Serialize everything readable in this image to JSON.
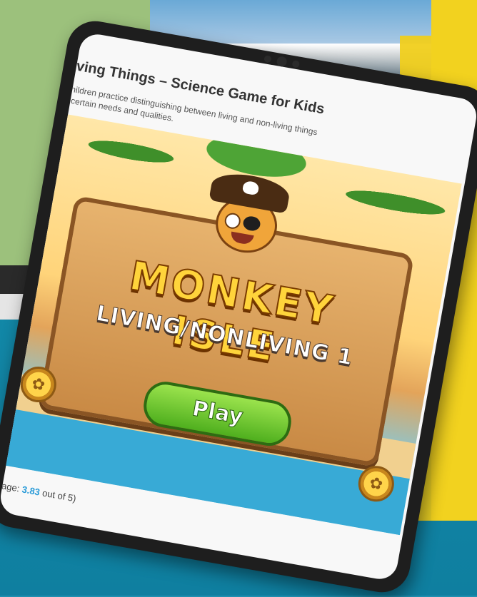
{
  "page": {
    "title": "n-living Things – Science Game for Kids",
    "description_line1": "helps children practice distinguishing between living and non-living things",
    "description_line2": "gs with certain needs and qualities."
  },
  "game": {
    "logo": "MONKEY ISLE",
    "subtitle": "LIVING/NONLIVING 1",
    "play_label": "Play",
    "coin_icon_left": "octopus-coin-icon",
    "coin_icon_right": "octopus-coin-icon"
  },
  "rating": {
    "prefix": "s, average: ",
    "average": "3.83",
    "suffix": " out of 5)"
  },
  "colors": {
    "accent_link": "#2a9bd8",
    "play_green": "#4faf1e",
    "logo_yellow": "#ffd43b"
  }
}
